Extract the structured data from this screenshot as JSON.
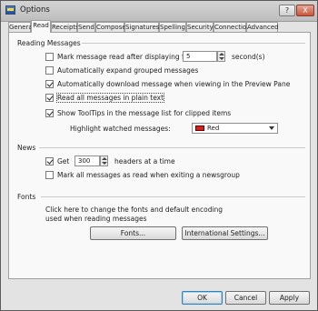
{
  "window": {
    "title": "Options",
    "help_label": "?",
    "close_label": "X"
  },
  "tabs": [
    {
      "label": "General"
    },
    {
      "label": "Read"
    },
    {
      "label": "Receipts"
    },
    {
      "label": "Send"
    },
    {
      "label": "Compose"
    },
    {
      "label": "Signatures"
    },
    {
      "label": "Spelling"
    },
    {
      "label": "Security"
    },
    {
      "label": "Connection"
    },
    {
      "label": "Advanced"
    }
  ],
  "active_tab": "Read",
  "reading": {
    "title": "Reading Messages",
    "mark_read": {
      "label": "Mark message read after displaying for",
      "checked": false,
      "value": "5",
      "unit": "second(s)"
    },
    "expand_grouped": {
      "label": "Automatically expand grouped messages",
      "checked": false
    },
    "auto_download": {
      "label": "Automatically download message when viewing in the Preview Pane",
      "checked": true
    },
    "plain_text": {
      "label": "Read all messages in plain text",
      "checked": true
    },
    "tooltips": {
      "label": "Show ToolTips in the message list for clipped items",
      "checked": true
    },
    "highlight": {
      "label": "Highlight watched messages:",
      "value": "Red",
      "color": "#d42020"
    }
  },
  "news": {
    "title": "News",
    "get": {
      "label": "Get",
      "checked": true,
      "value": "300",
      "suffix": "headers at a time"
    },
    "mark_all_read": {
      "label": "Mark all messages as read when exiting a newsgroup",
      "checked": false
    }
  },
  "fonts": {
    "title": "Fonts",
    "description_line1": "Click here to change the fonts and default encoding",
    "description_line2": "used when reading messages",
    "fonts_button": "Fonts...",
    "intl_button": "International Settings..."
  },
  "footer": {
    "ok": "OK",
    "cancel": "Cancel",
    "apply": "Apply"
  }
}
